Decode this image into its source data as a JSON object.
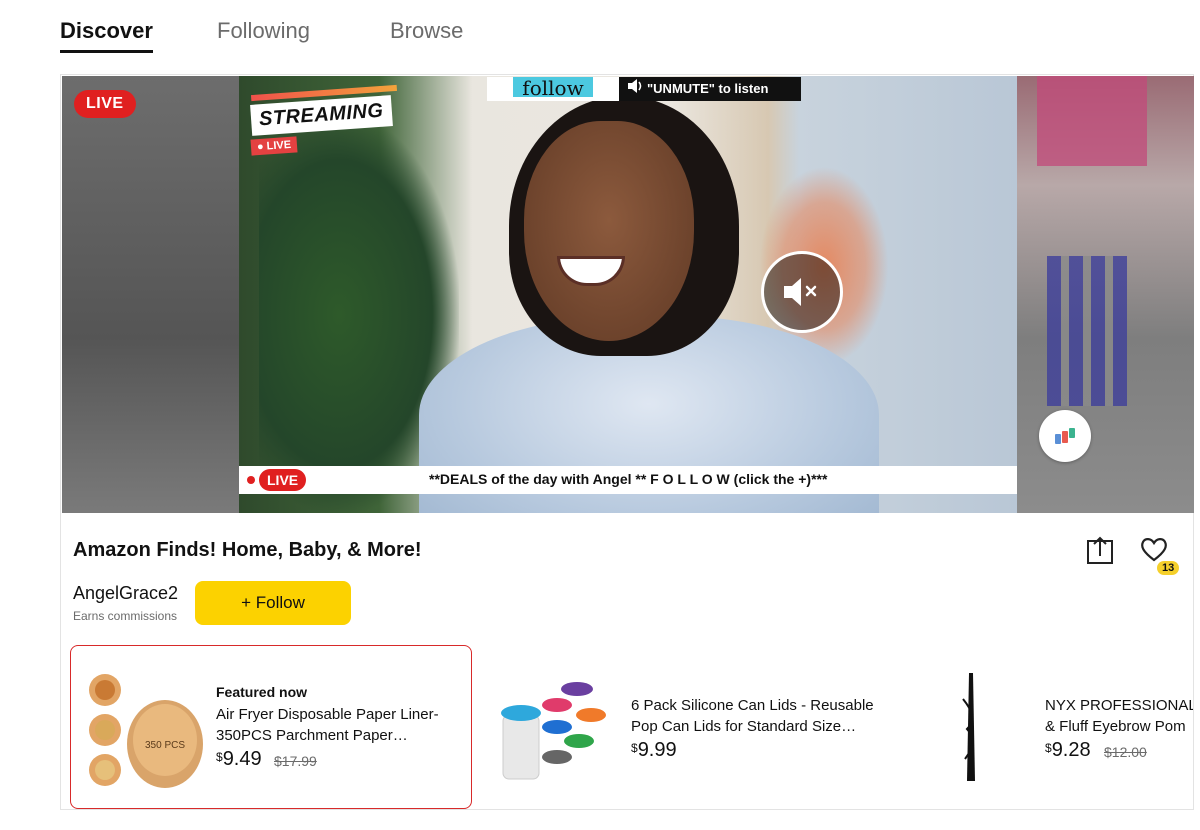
{
  "tabs": [
    {
      "label": "Discover",
      "active": true
    },
    {
      "label": "Following",
      "active": false
    },
    {
      "label": "Browse",
      "active": false
    }
  ],
  "video": {
    "live_badge": "LIVE",
    "overlay_streaming": "STREAMING",
    "overlay_live_small": "LIVE",
    "follow_banner": "follow",
    "unmute_banner": "\"UNMUTE\" to listen",
    "ticker_live": "LIVE",
    "ticker_text": "**DEALS of the day with Angel ** F O L L O W (click the +)***",
    "mute_icon": "muted-speaker-icon"
  },
  "stream": {
    "title": "Amazon Finds! Home, Baby, & More!",
    "likes": "13",
    "creator": "AngelGrace2",
    "creator_note": "Earns commissions",
    "follow_label": "+ Follow"
  },
  "products": [
    {
      "featured_label": "Featured now",
      "name_line1": "Air Fryer Disposable Paper Liner-",
      "name_line2": "350PCS Parchment Paper…",
      "price_symbol": "$",
      "price": "9.49",
      "old_price": "$17.99",
      "image_label": "350 PCS"
    },
    {
      "name_line1": "6 Pack Silicone Can Lids - Reusable",
      "name_line2": "Pop Can Lids for Standard Size…",
      "price_symbol": "$",
      "price": "9.99"
    },
    {
      "name_line1": "NYX PROFESSIONAL",
      "name_line2": "& Fluff Eyebrow Pom",
      "price_symbol": "$",
      "price": "9.28",
      "old_price": "$12.00"
    }
  ],
  "colors": {
    "live_red": "#e02020",
    "follow_yellow": "#fcd200",
    "featured_border": "#d82a2a"
  }
}
